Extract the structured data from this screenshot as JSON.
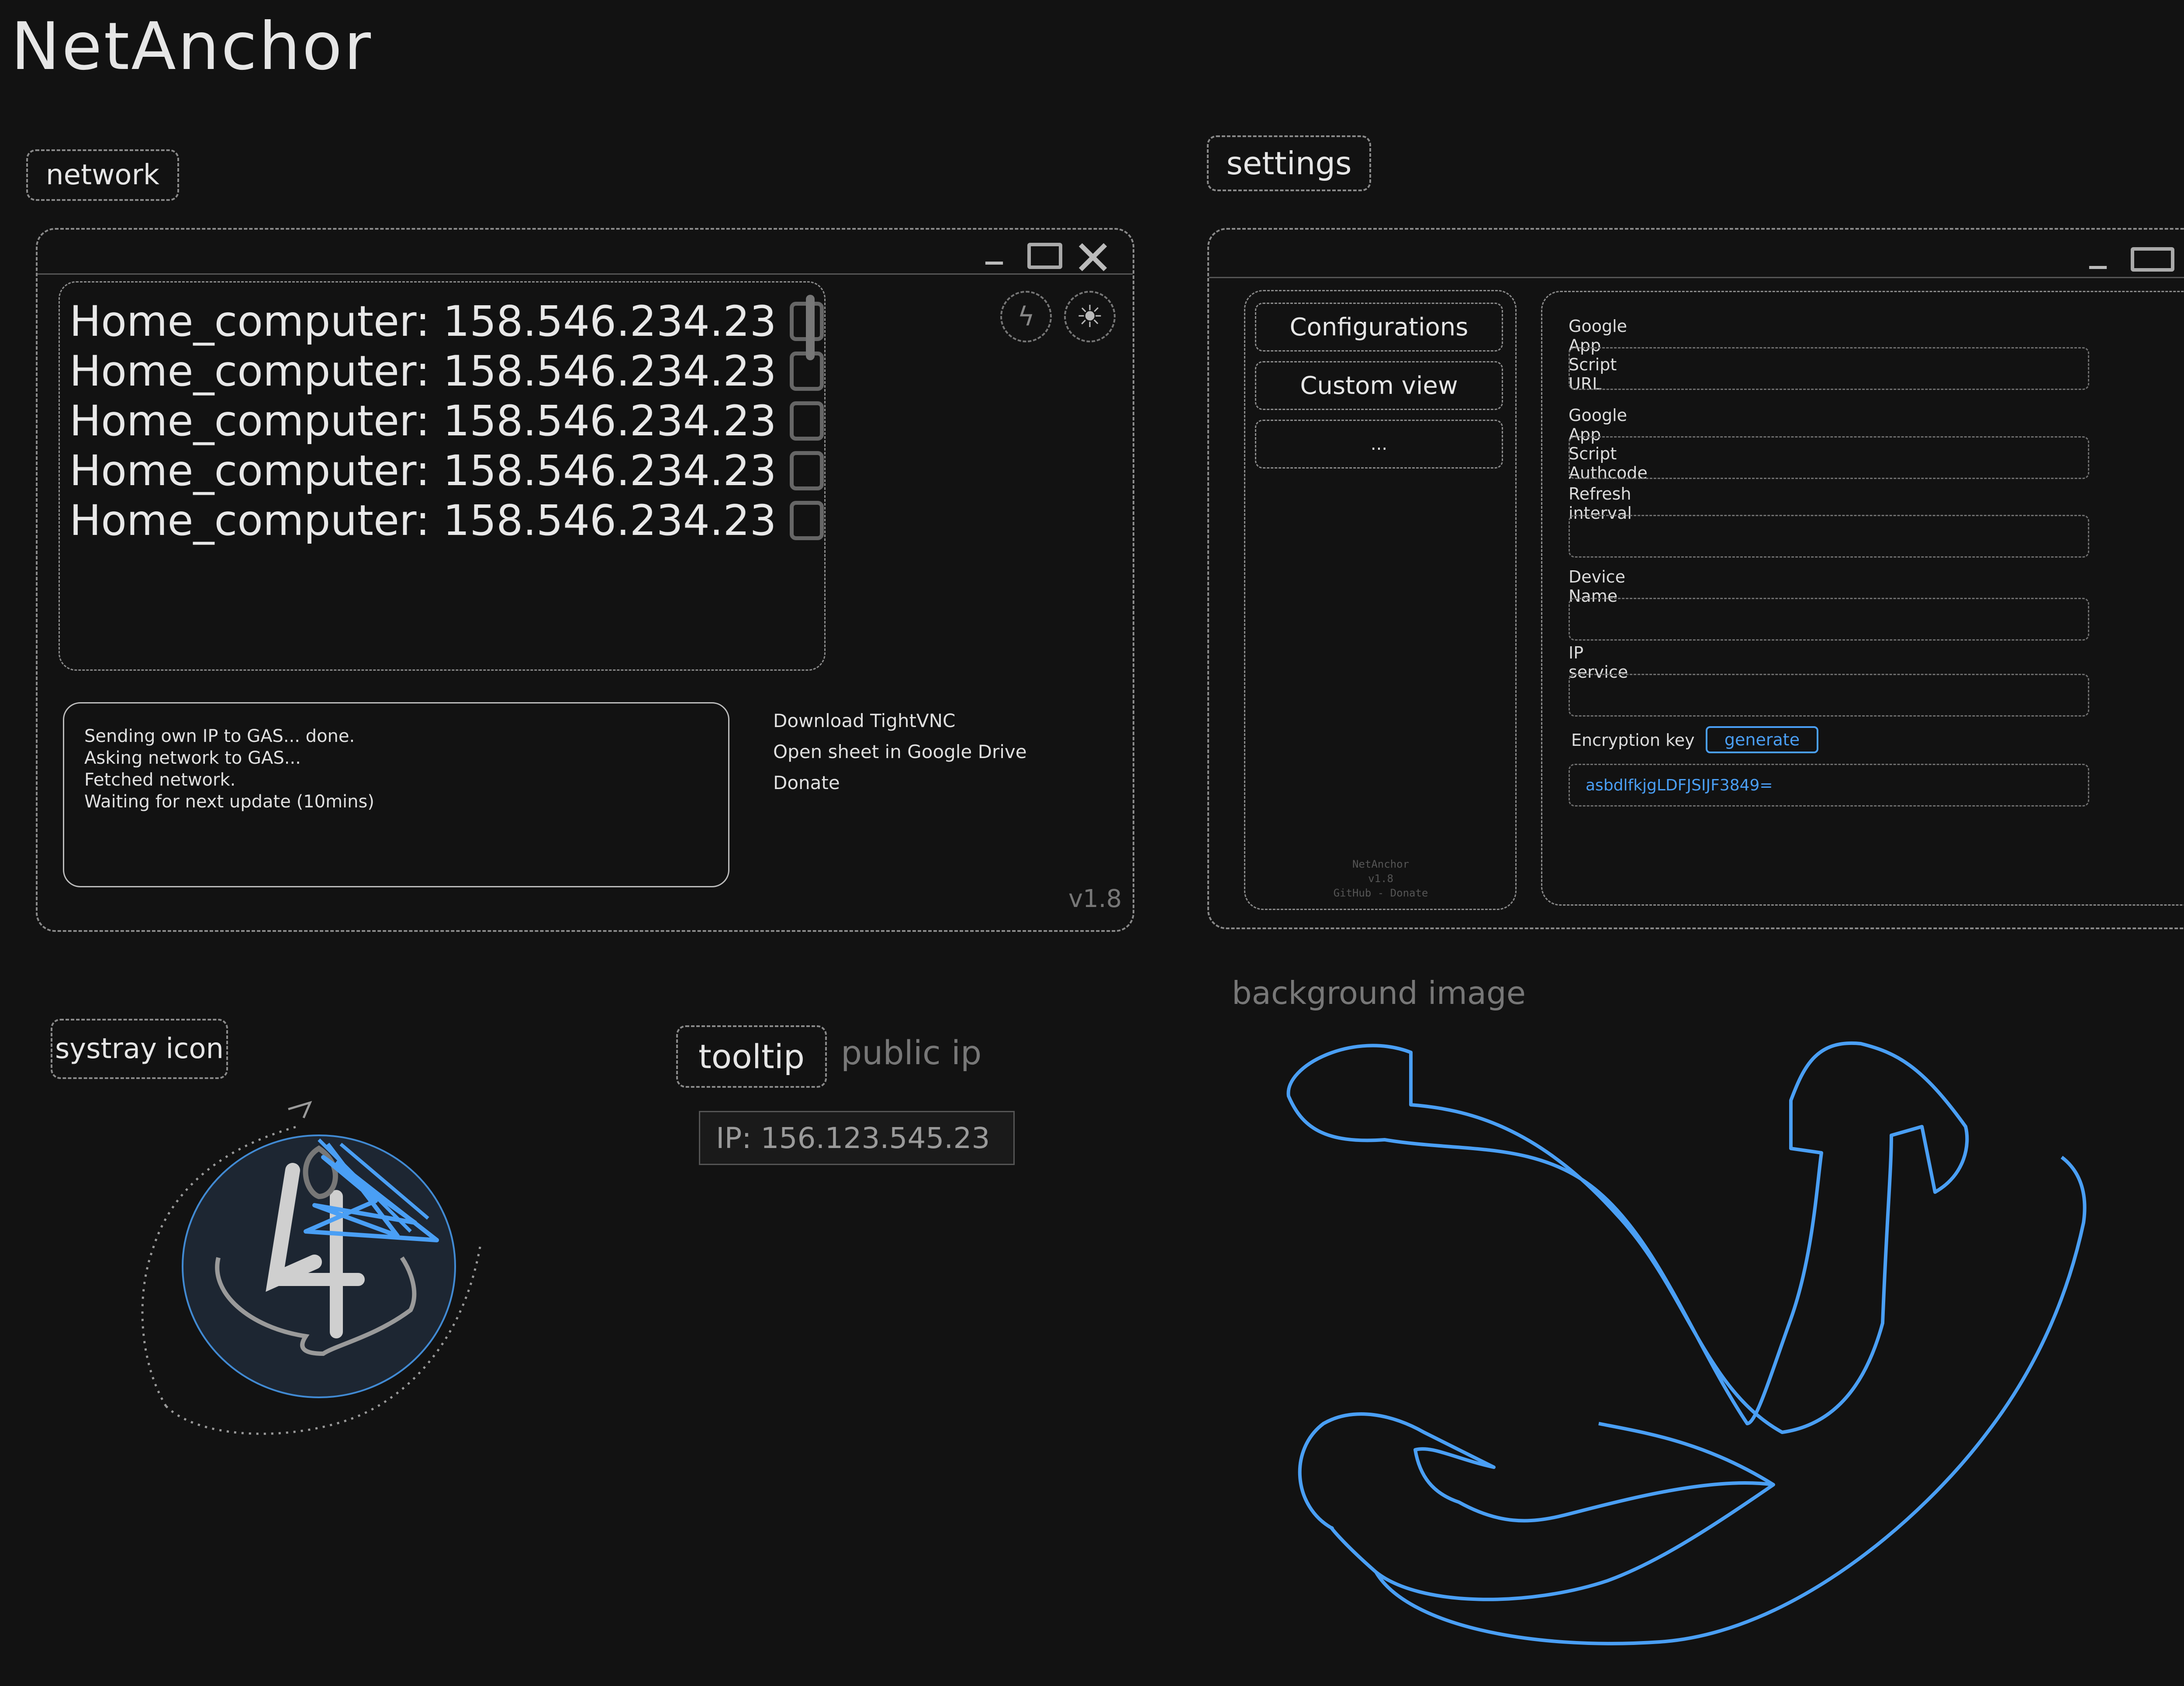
{
  "app": {
    "title": "NetAnchor"
  },
  "network": {
    "label": "network",
    "rows": [
      {
        "name": "Home_computer:",
        "ip": "158.546.234.23"
      },
      {
        "name": "Home_computer:",
        "ip": "158.546.234.23"
      },
      {
        "name": "Home_computer:",
        "ip": "158.546.234.23"
      },
      {
        "name": "Home_computer:",
        "ip": "158.546.234.23"
      },
      {
        "name": "Home_computer:",
        "ip": "158.546.234.23"
      }
    ],
    "log_lines": [
      "Sending own IP to GAS... done.",
      "Asking network to GAS...",
      "Fetched network.",
      "Waiting for next update (10mins)"
    ],
    "links": [
      "Download TightVNC",
      "Open sheet in Google Drive",
      "Donate"
    ],
    "version": "v1.8"
  },
  "settings": {
    "label": "settings",
    "nav": [
      "Configurations",
      "Custom view",
      "..."
    ],
    "fields": [
      {
        "label": "Google App Script URL",
        "value": ""
      },
      {
        "label": "Google App Script Authcode",
        "value": ""
      },
      {
        "label": "Refresh interval",
        "value": ""
      },
      {
        "label": "Device Name",
        "value": ""
      },
      {
        "label": "IP service",
        "value": ""
      }
    ],
    "encryption": {
      "label": "Encryption key",
      "button": "generate",
      "value": "asbdlfkjgLDFJSIJF3849="
    },
    "footer": {
      "name": "NetAnchor",
      "version": "v1.8",
      "links": "GitHub - Donate"
    }
  },
  "systray": {
    "label": "systray icon"
  },
  "tooltip": {
    "label": "tooltip",
    "note": "public ip",
    "text": "IP: 156.123.545.23"
  },
  "background": {
    "label": "background image"
  },
  "colors": {
    "accent": "#4a9ff5",
    "background": "#121212",
    "dashed": "#8a8a8a"
  }
}
